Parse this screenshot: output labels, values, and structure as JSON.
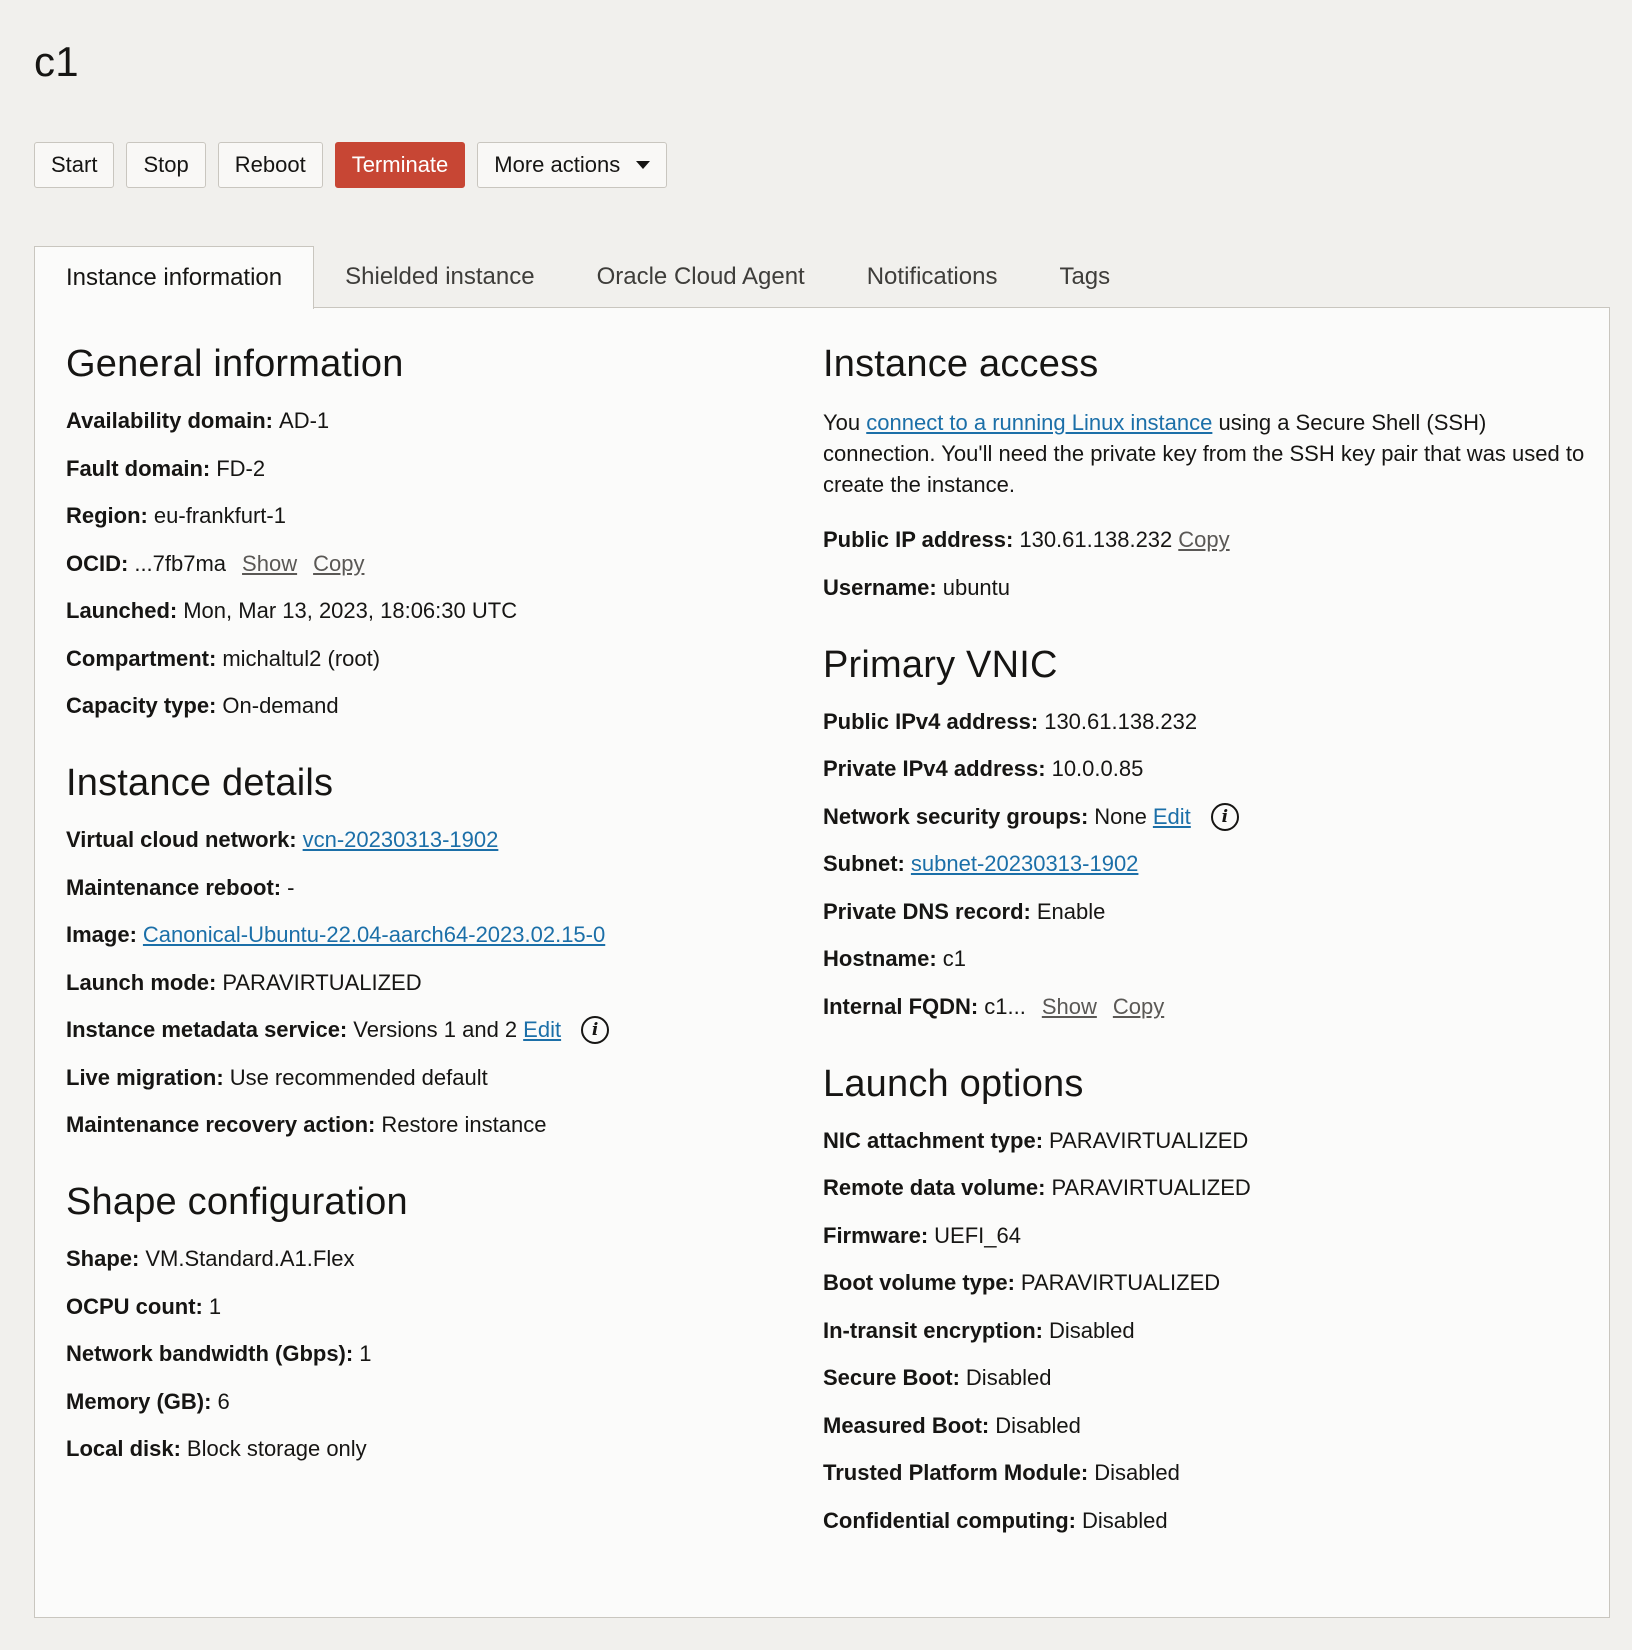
{
  "title": "c1",
  "actions": {
    "start": "Start",
    "stop": "Stop",
    "reboot": "Reboot",
    "terminate": "Terminate",
    "more": "More actions"
  },
  "tabs": [
    "Instance information",
    "Shielded instance",
    "Oracle Cloud Agent",
    "Notifications",
    "Tags"
  ],
  "general": {
    "heading": "General information",
    "availability_domain": {
      "label": "Availability domain:",
      "value": "AD-1"
    },
    "fault_domain": {
      "label": "Fault domain:",
      "value": "FD-2"
    },
    "region": {
      "label": "Region:",
      "value": "eu-frankfurt-1"
    },
    "ocid": {
      "label": "OCID:",
      "value": "...7fb7ma",
      "show": "Show",
      "copy": "Copy"
    },
    "launched": {
      "label": "Launched:",
      "value": "Mon, Mar 13, 2023, 18:06:30 UTC"
    },
    "compartment": {
      "label": "Compartment:",
      "value": "michaltul2 (root)"
    },
    "capacity_type": {
      "label": "Capacity type:",
      "value": "On-demand"
    }
  },
  "details": {
    "heading": "Instance details",
    "vcn": {
      "label": "Virtual cloud network:",
      "value": "vcn-20230313-1902"
    },
    "maintenance_reboot": {
      "label": "Maintenance reboot:",
      "value": "-"
    },
    "image": {
      "label": "Image:",
      "value": "Canonical-Ubuntu-22.04-aarch64-2023.02.15-0"
    },
    "launch_mode": {
      "label": "Launch mode:",
      "value": "PARAVIRTUALIZED"
    },
    "metadata_service": {
      "label": "Instance metadata service:",
      "value": "Versions 1 and 2",
      "edit": "Edit"
    },
    "live_migration": {
      "label": "Live migration:",
      "value": "Use recommended default"
    },
    "maintenance_recovery": {
      "label": "Maintenance recovery action:",
      "value": "Restore instance"
    }
  },
  "shape": {
    "heading": "Shape configuration",
    "shape": {
      "label": "Shape:",
      "value": "VM.Standard.A1.Flex"
    },
    "ocpu": {
      "label": "OCPU count:",
      "value": "1"
    },
    "bandwidth": {
      "label": "Network bandwidth (Gbps):",
      "value": "1"
    },
    "memory": {
      "label": "Memory (GB):",
      "value": "6"
    },
    "local_disk": {
      "label": "Local disk:",
      "value": "Block storage only"
    }
  },
  "access": {
    "heading": "Instance access",
    "text_before": "You ",
    "link": "connect to a running Linux instance",
    "text_after": " using a Secure Shell (SSH) connection. You'll need the private key from the SSH key pair that was used to create the instance.",
    "public_ip": {
      "label": "Public IP address:",
      "value": "130.61.138.232",
      "copy": "Copy"
    },
    "username": {
      "label": "Username:",
      "value": "ubuntu"
    }
  },
  "vnic": {
    "heading": "Primary VNIC",
    "public_ipv4": {
      "label": "Public IPv4 address:",
      "value": "130.61.138.232"
    },
    "private_ipv4": {
      "label": "Private IPv4 address:",
      "value": "10.0.0.85"
    },
    "nsg": {
      "label": "Network security groups:",
      "value": "None",
      "edit": "Edit"
    },
    "subnet": {
      "label": "Subnet:",
      "value": "subnet-20230313-1902"
    },
    "dns": {
      "label": "Private DNS record:",
      "value": "Enable"
    },
    "hostname": {
      "label": "Hostname:",
      "value": "c1"
    },
    "fqdn": {
      "label": "Internal FQDN:",
      "value": "c1...",
      "show": "Show",
      "copy": "Copy"
    }
  },
  "launch": {
    "heading": "Launch options",
    "nic": {
      "label": "NIC attachment type:",
      "value": "PARAVIRTUALIZED"
    },
    "remote_volume": {
      "label": "Remote data volume:",
      "value": "PARAVIRTUALIZED"
    },
    "firmware": {
      "label": "Firmware:",
      "value": "UEFI_64"
    },
    "boot_volume": {
      "label": "Boot volume type:",
      "value": "PARAVIRTUALIZED"
    },
    "transit_enc": {
      "label": "In-transit encryption:",
      "value": "Disabled"
    },
    "secure_boot": {
      "label": "Secure Boot:",
      "value": "Disabled"
    },
    "measured_boot": {
      "label": "Measured Boot:",
      "value": "Disabled"
    },
    "tpm": {
      "label": "Trusted Platform Module:",
      "value": "Disabled"
    },
    "confidential": {
      "label": "Confidential computing:",
      "value": "Disabled"
    }
  },
  "colors": {
    "terminate": "#c74634",
    "link": "#1b6fa8",
    "background": "#f1f0ed"
  }
}
